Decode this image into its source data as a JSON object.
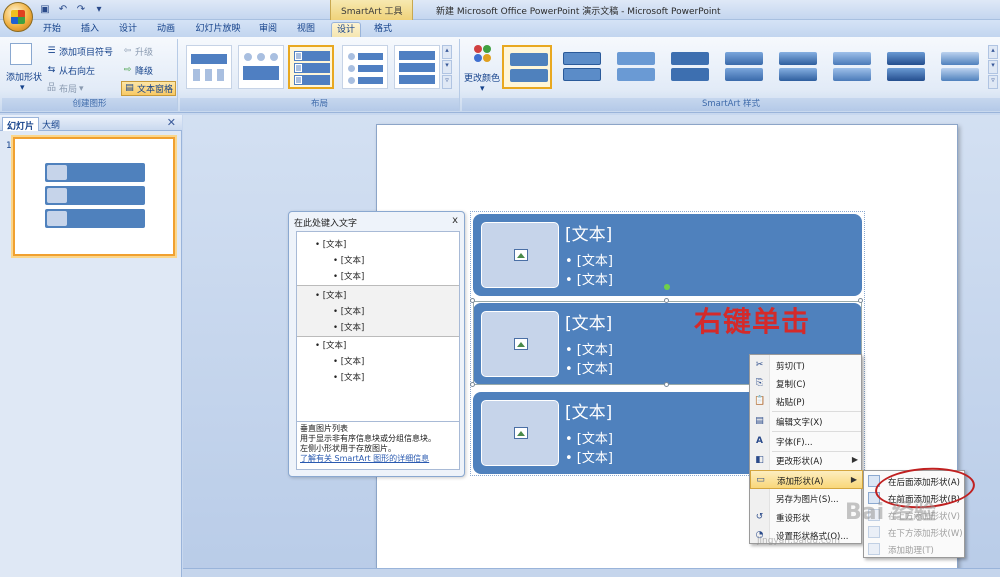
{
  "window": {
    "tool_context_title": "SmartArt 工具",
    "app_title": "新建 Microsoft Office PowerPoint 演示文稿 - Microsoft PowerPoint"
  },
  "ribbon_tabs": [
    "开始",
    "插入",
    "设计",
    "动画",
    "幻灯片放映",
    "审阅",
    "视图",
    "设计",
    "格式"
  ],
  "ribbon": {
    "create_group": {
      "label": "创建图形",
      "add_shape": "添加形状",
      "add_bullet": "添加项目符号",
      "right_to_left": "从右向左",
      "layout": "布局",
      "promote": "升级",
      "demote": "降级",
      "text_pane": "文本窗格"
    },
    "layout_group": {
      "label": "布局"
    },
    "styles_group": {
      "label": "SmartArt 样式",
      "change_colors": "更改颜色"
    }
  },
  "left_pane": {
    "tabs": [
      "幻灯片",
      "大纲"
    ],
    "close": "✕",
    "slide_number": "1"
  },
  "text_pane": {
    "title": "在此处键入文字",
    "close": "x",
    "items": [
      {
        "top": "[文本]",
        "children": [
          "[文本]",
          "[文本]"
        ]
      },
      {
        "top": "[文本]",
        "children": [
          "[文本]",
          "[文本]"
        ]
      },
      {
        "top": "[文本]",
        "children": [
          "[文本]",
          "[文本]"
        ]
      }
    ],
    "desc_title": "垂直图片列表",
    "desc_line1": "用于显示非有序信息块或分组信息块。",
    "desc_line2": "左侧小形状用于存放图片。",
    "desc_link": "了解有关 SmartArt 图形的详细信息"
  },
  "smartart": {
    "rows": [
      {
        "title": "[文本]",
        "bullets": [
          "• [文本]",
          "• [文本]"
        ]
      },
      {
        "title": "[文本]",
        "bullets": [
          "• [文本]",
          "• [文本]"
        ]
      },
      {
        "title": "[文本]",
        "bullets": [
          "• [文本]",
          "• [文本]"
        ]
      }
    ]
  },
  "annotation": "右键单击",
  "context_menu": {
    "items": [
      {
        "label": "剪切(T)",
        "icon": "scissors-icon",
        "glyph": "✂"
      },
      {
        "label": "复制(C)",
        "icon": "copy-icon",
        "glyph": "⎘"
      },
      {
        "label": "粘贴(P)",
        "icon": "paste-icon",
        "glyph": "📋"
      },
      {
        "label": "编辑文字(X)",
        "icon": "edit-text-icon",
        "glyph": "▤"
      },
      {
        "label": "字体(F)...",
        "icon": "font-icon",
        "glyph": "A"
      },
      {
        "label": "更改形状(A)",
        "icon": "change-shape-icon",
        "glyph": "◧"
      },
      {
        "label": "添加形状(A)",
        "icon": "add-shape-icon",
        "glyph": "▭"
      },
      {
        "label": "另存为图片(S)...",
        "icon": "",
        "glyph": ""
      },
      {
        "label": "重设形状",
        "icon": "reset-icon",
        "glyph": "↺"
      },
      {
        "label": "设置形状格式(O)...",
        "icon": "format-shape-icon",
        "glyph": "◔"
      }
    ]
  },
  "submenu": {
    "items": [
      {
        "label": "在后面添加形状(A)",
        "disabled": false
      },
      {
        "label": "在前面添加形状(B)",
        "disabled": false
      },
      {
        "label": "在上方添加形状(V)",
        "disabled": true
      },
      {
        "label": "在下方添加形状(W)",
        "disabled": true
      },
      {
        "label": "添加助理(T)",
        "disabled": true
      }
    ]
  },
  "watermark": {
    "text": "Bai 经验",
    "sub": "jingyan.baidu.com"
  },
  "colors": {
    "smartart_fill": "#4f81bd",
    "picture_fill": "#c6d4ea",
    "annotation": "#d42a2a",
    "menu_highlight": "#f9d77a"
  }
}
